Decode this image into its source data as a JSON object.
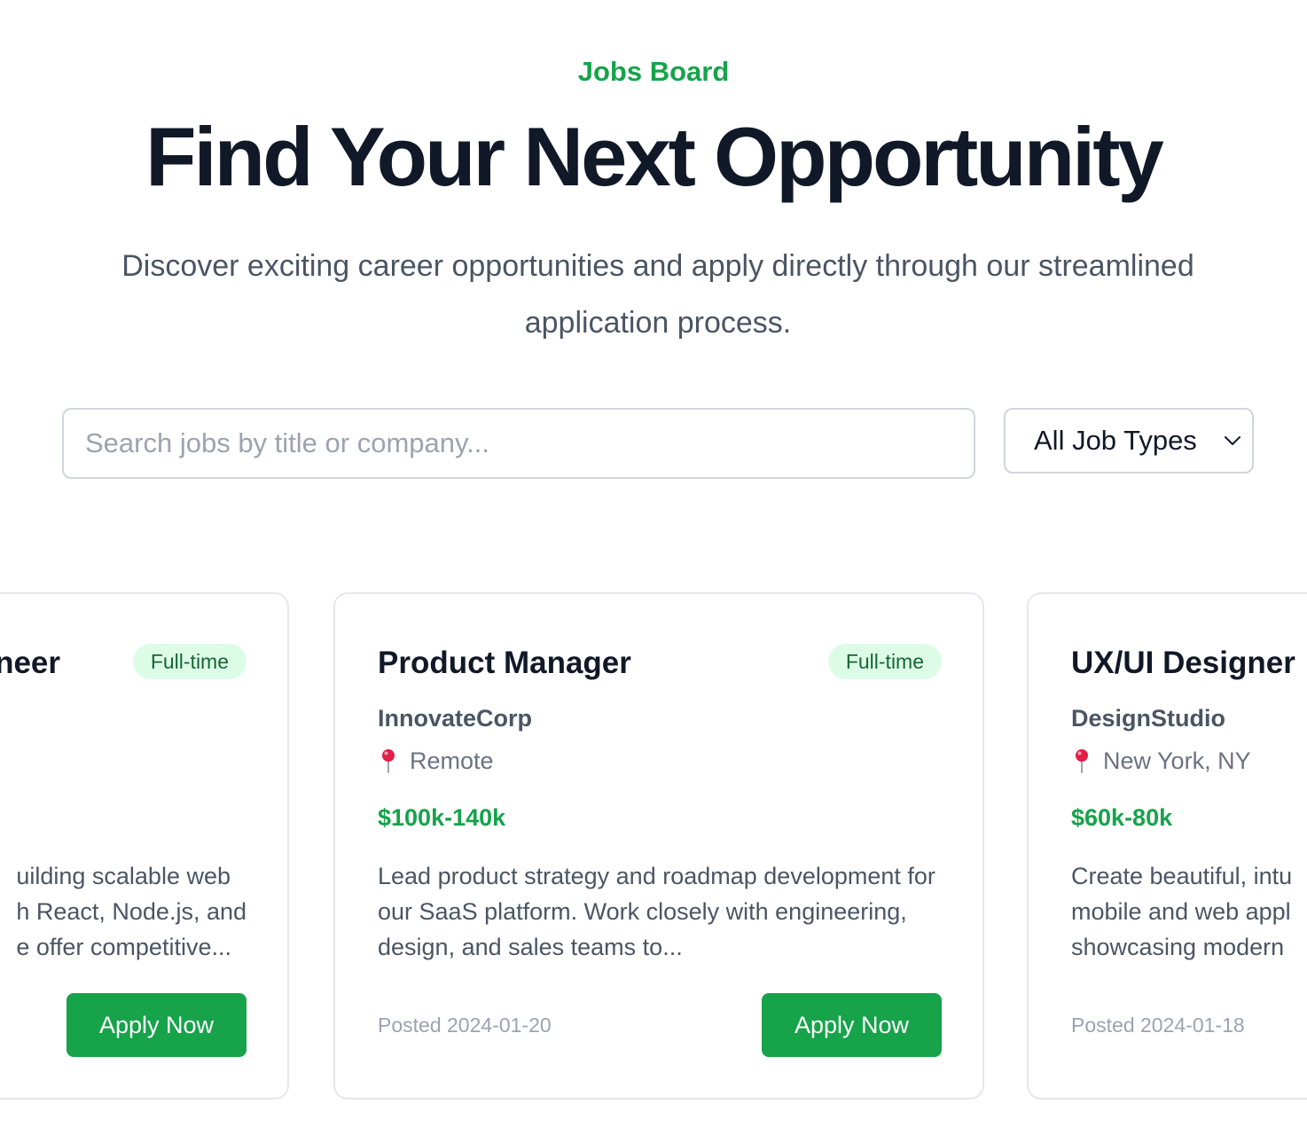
{
  "header": {
    "eyebrow": "Jobs Board",
    "title": "Find Your Next Opportunity",
    "subtitle": "Discover exciting career opportunities and apply directly through our streamlined application process."
  },
  "search": {
    "placeholder": "Search jobs by title or company...",
    "value": ""
  },
  "filter": {
    "selected": "All Job Types",
    "icon": "chevron-down-icon"
  },
  "jobs": [
    {
      "title": "neer",
      "type": "Full-time",
      "company": "",
      "location": "",
      "salary": "",
      "description": "uilding scalable web h React, Node.js, and e offer competitive...",
      "desc_lines": [
        "uilding scalable web",
        "h React, Node.js, and",
        "e offer competitive..."
      ],
      "posted": "",
      "apply_label": "Apply Now"
    },
    {
      "title": "Product Manager",
      "type": "Full-time",
      "company": "InnovateCorp",
      "location": "Remote",
      "salary": "$100k-140k",
      "description": "Lead product strategy and roadmap development for our SaaS platform. Work closely with engineering, design, and sales teams to...",
      "posted": "Posted 2024-01-20",
      "apply_label": "Apply Now"
    },
    {
      "title": "UX/UI Designer",
      "type": "",
      "company": "DesignStudio",
      "location": "New York, NY",
      "salary": "$60k-80k",
      "desc_lines": [
        "Create beautiful, intu",
        "mobile and web appl",
        "showcasing modern"
      ],
      "posted": "Posted 2024-01-18",
      "apply_label": ""
    }
  ],
  "colors": {
    "accent": "#16a34a",
    "badge_bg": "#dcfce7",
    "badge_text": "#166534",
    "heading": "#111827",
    "body_text": "#4b5563"
  }
}
